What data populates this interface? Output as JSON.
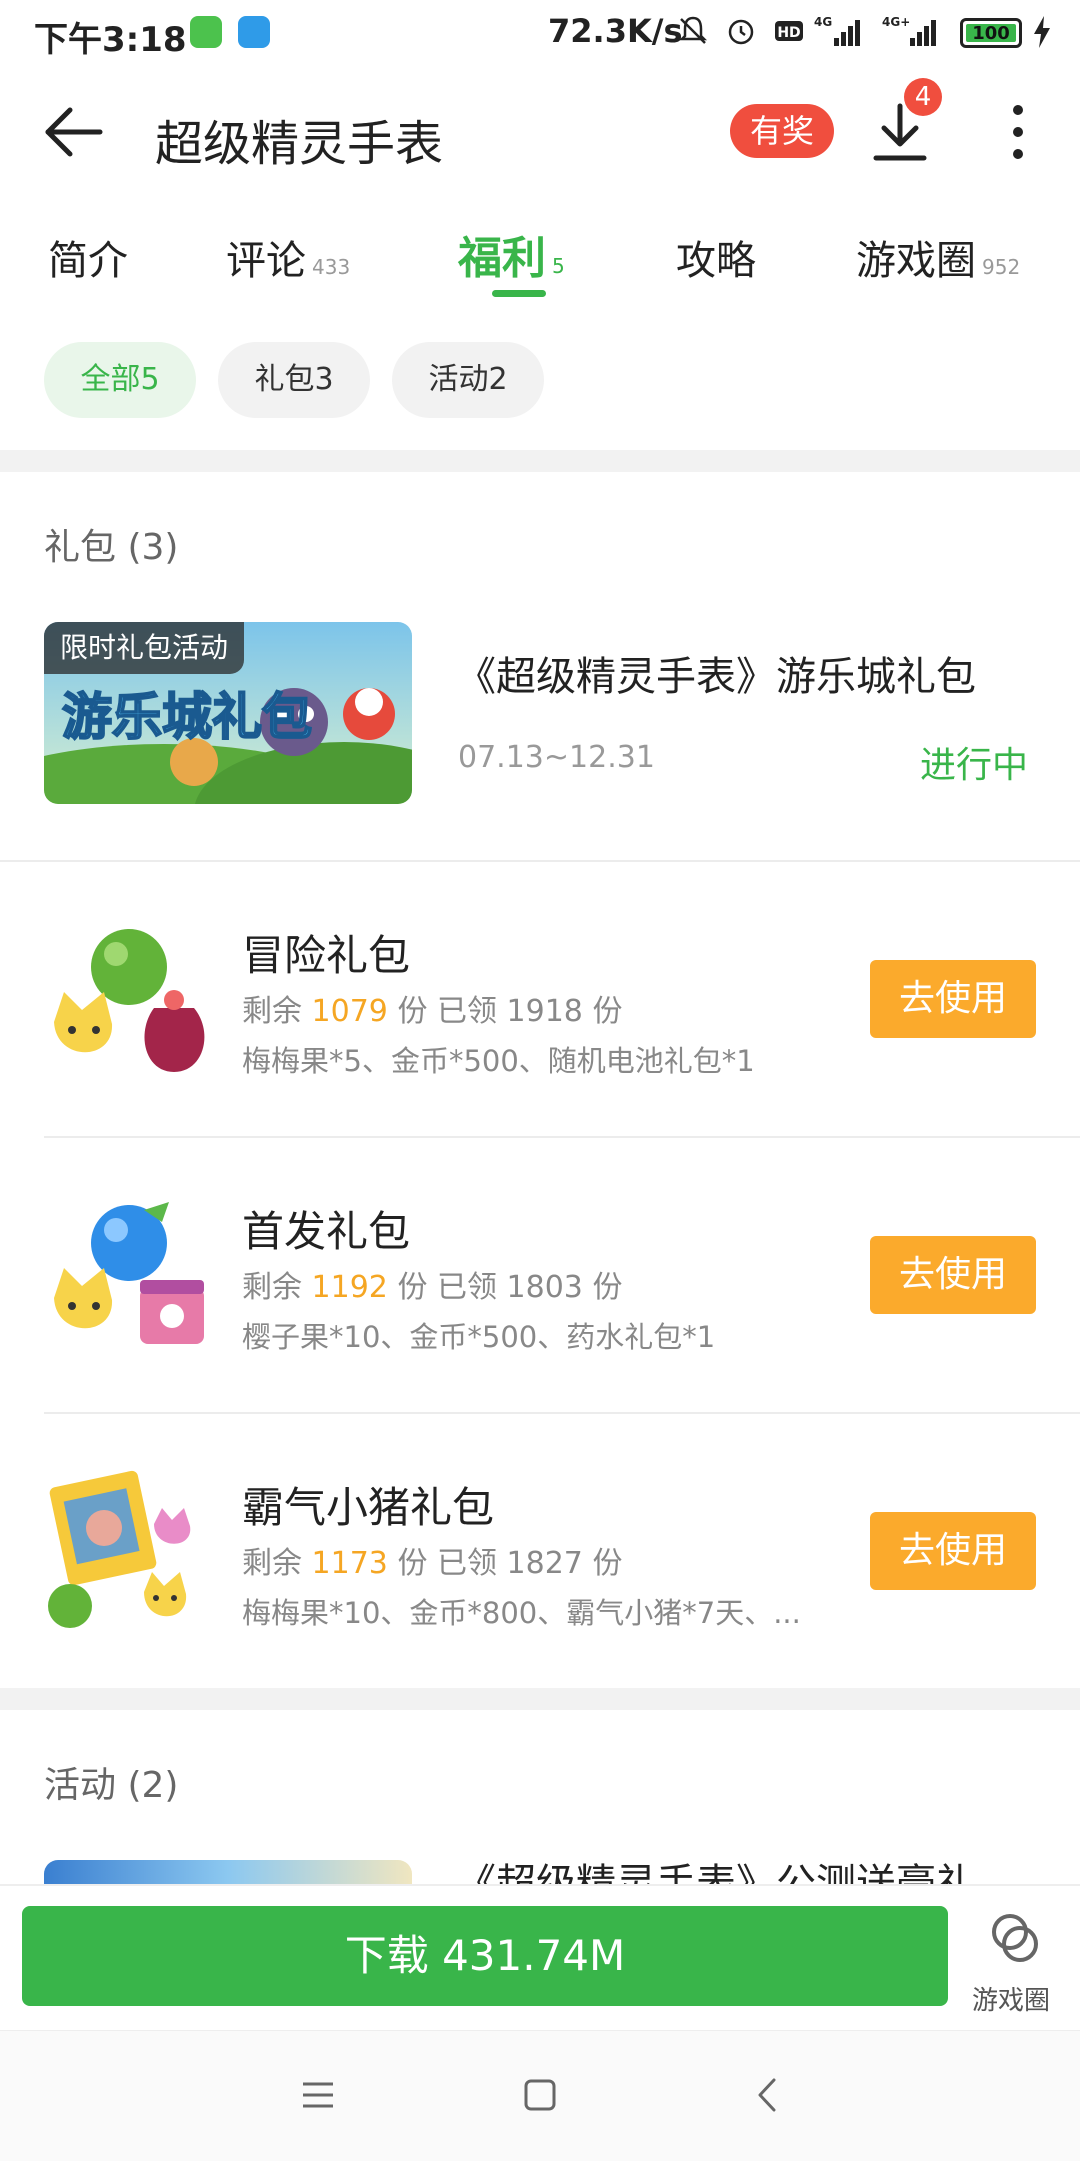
{
  "status_bar": {
    "time": "下午3:18",
    "net_speed": "72.3K/s",
    "battery": "100"
  },
  "header": {
    "title": "超级精灵手表",
    "prize_badge": "有奖",
    "download_count": "4"
  },
  "tabs": [
    {
      "label": "简介",
      "count": ""
    },
    {
      "label": "评论",
      "count": "433"
    },
    {
      "label": "福利",
      "count": "5"
    },
    {
      "label": "攻略",
      "count": ""
    },
    {
      "label": "游戏圈",
      "count": "952"
    }
  ],
  "filters": [
    "全部5",
    "礼包3",
    "活动2"
  ],
  "gift_section": {
    "heading": "礼包 (3)",
    "event": {
      "tag": "限时礼包活动",
      "banner_text": "游乐城礼包",
      "title": "《超级精灵手表》游乐城礼包",
      "date": "07.13~12.31",
      "status": "进行中"
    },
    "gifts": [
      {
        "name": "冒险礼包",
        "remain_label": "剩余",
        "remain": "1079",
        "unit1": "份",
        "claimed_label": "已领",
        "claimed": "1918",
        "unit2": "份",
        "desc": "梅梅果*5、金币*500、随机电池礼包*1",
        "button": "去使用"
      },
      {
        "name": "首发礼包",
        "remain_label": "剩余",
        "remain": "1192",
        "unit1": "份",
        "claimed_label": "已领",
        "claimed": "1803",
        "unit2": "份",
        "desc": "樱子果*10、金币*500、药水礼包*1",
        "button": "去使用"
      },
      {
        "name": "霸气小猪礼包",
        "remain_label": "剩余",
        "remain": "1173",
        "unit1": "份",
        "claimed_label": "已领",
        "claimed": "1827",
        "unit2": "份",
        "desc": "梅梅果*10、金币*800、霸气小猪*7天、...",
        "button": "去使用"
      }
    ]
  },
  "activity_section": {
    "heading": "活动 (2)",
    "first_title": "《超级精灵手表》公测送豪礼"
  },
  "bottom": {
    "download_button": "下载 431.74M",
    "circle_label": "游戏圈"
  },
  "colors": {
    "accent": "#39b54a",
    "warning": "#fbaa2c",
    "badge": "#f04e3e",
    "number": "#f5a623"
  }
}
